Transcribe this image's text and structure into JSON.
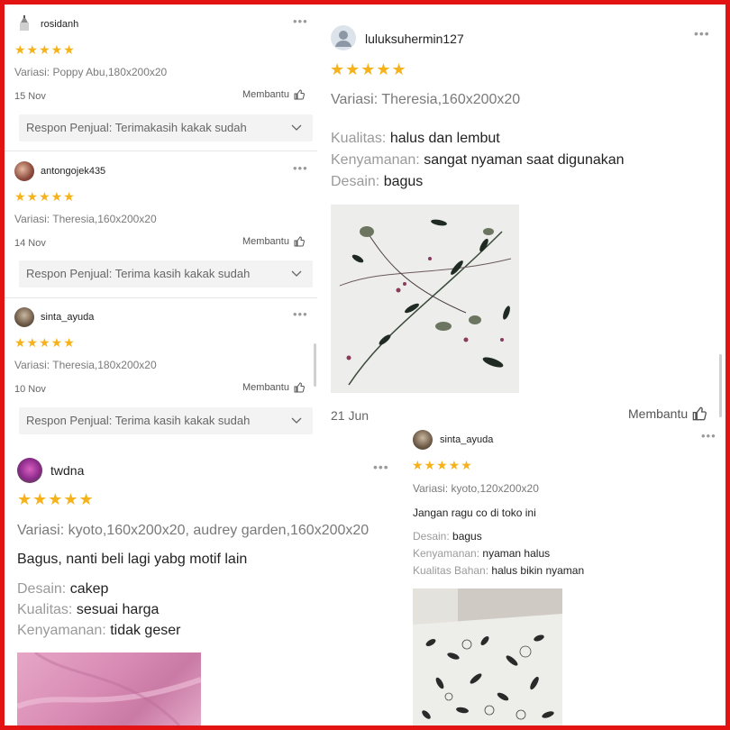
{
  "panel1": {
    "reviews": [
      {
        "user": "rosidanh",
        "stars": "★★★★★",
        "variant": "Variasi: Poppy Abu,180x200x20",
        "date": "15 Nov",
        "helpful": "Membantu",
        "response": "Respon Penjual: Terimakasih kakak sudah"
      },
      {
        "user": "antongojek435",
        "stars": "★★★★★",
        "variant": "Variasi: Theresia,160x200x20",
        "date": "14 Nov",
        "helpful": "Membantu",
        "response": "Respon Penjual: Terima kasih kakak sudah"
      },
      {
        "user": "sinta_ayuda",
        "stars": "★★★★★",
        "variant": "Variasi: Theresia,180x200x20",
        "date": "10 Nov",
        "helpful": "Membantu",
        "response": "Respon Penjual: Terima kasih kakak sudah"
      }
    ],
    "more": "•••"
  },
  "panel2": {
    "user": "luluksuhermin127",
    "stars": "★★★★★",
    "variant": "Variasi: Theresia,160x200x20",
    "attrs": [
      {
        "k": "Kualitas:",
        "v": "halus dan lembut"
      },
      {
        "k": "Kenyamanan:",
        "v": "sangat nyaman saat digunakan"
      },
      {
        "k": "Desain:",
        "v": "bagus"
      }
    ],
    "date": "21 Jun",
    "helpful": "Membantu",
    "more": "•••"
  },
  "panel3": {
    "user": "twdna",
    "stars": "★★★★★",
    "variant": "Variasi: kyoto,160x200x20, audrey garden,160x200x20",
    "comment": "Bagus, nanti beli lagi yabg motif lain",
    "attrs": [
      {
        "k": "Desain:",
        "v": "cakep"
      },
      {
        "k": "Kualitas:",
        "v": "sesuai harga"
      },
      {
        "k": "Kenyamanan:",
        "v": "tidak geser"
      }
    ],
    "more": "•••"
  },
  "panel4": {
    "user": "sinta_ayuda",
    "stars": "★★★★★",
    "variant": "Variasi: kyoto,120x200x20",
    "comment": "Jangan ragu co di toko ini",
    "attrs": [
      {
        "k": "Desain:",
        "v": "bagus"
      },
      {
        "k": "Kenyamanan:",
        "v": "nyaman  halus"
      },
      {
        "k": "Kualitas Bahan:",
        "v": "halus bikin nyaman"
      }
    ],
    "more": "•••"
  },
  "colors": {
    "frame": "#e41313",
    "star": "#f6b21a",
    "muted": "#9a9a9a"
  }
}
